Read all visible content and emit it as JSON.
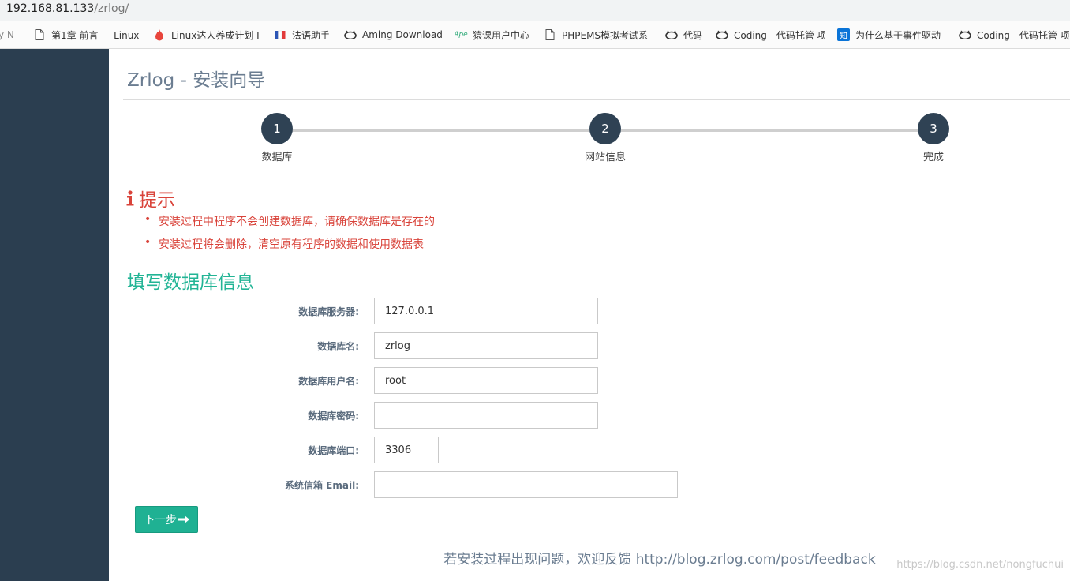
{
  "browser": {
    "url_host": "192.168.81.133",
    "url_path": "/zrlog/",
    "bookmarks": [
      {
        "label": "y N",
        "icon": "none"
      },
      {
        "label": "第1章 前言 — Linux",
        "icon": "page-icon"
      },
      {
        "label": "Linux达人养成计划 I",
        "icon": "flame-icon"
      },
      {
        "label": "法语助手",
        "icon": "flag-icon"
      },
      {
        "label": "Aming Download",
        "icon": "cat-icon"
      },
      {
        "label": "猿课用户中心",
        "icon": "apelearn-icon"
      },
      {
        "label": "PHPEMS模拟考试系",
        "icon": "page-icon"
      },
      {
        "label": "代码",
        "icon": "cat-icon"
      },
      {
        "label": "Coding - 代码托管 项",
        "icon": "cat-icon"
      },
      {
        "label": "为什么基于事件驱动",
        "icon": "zhihu-icon"
      },
      {
        "label": "Coding - 代码托管 项",
        "icon": "cat-icon"
      }
    ]
  },
  "page": {
    "title": "Zrlog - 安装向导",
    "steps": [
      {
        "number": "1",
        "label": "数据库"
      },
      {
        "number": "2",
        "label": "网站信息"
      },
      {
        "number": "3",
        "label": "完成"
      }
    ],
    "tip": {
      "title": "提示",
      "items": [
        "安装过程中程序不会创建数据库，请确保数据库是存在的",
        "安装过程将会删除，清空原有程序的数据和使用数据表"
      ]
    },
    "form": {
      "title": "填写数据库信息",
      "fields": [
        {
          "label": "数据库服务器:",
          "value": "127.0.0.1"
        },
        {
          "label": "数据库名:",
          "value": "zrlog"
        },
        {
          "label": "数据库用户名:",
          "value": "root"
        },
        {
          "label": "数据库密码:",
          "value": ""
        },
        {
          "label": "数据库端口:",
          "value": "3306"
        },
        {
          "label": "系统信箱 Email:",
          "value": ""
        }
      ],
      "next_label": "下一步"
    },
    "footer": "若安装过程出现问题，欢迎反馈 http://blog.zrlog.com/post/feedback",
    "watermark": "https://blog.csdn.net/nongfuchui"
  },
  "colors": {
    "sidebar": "#2b3e50",
    "step_circle": "#2f4254",
    "tip_red": "#d9433a",
    "form_title_green": "#22b495",
    "button_green": "#1fb193"
  }
}
